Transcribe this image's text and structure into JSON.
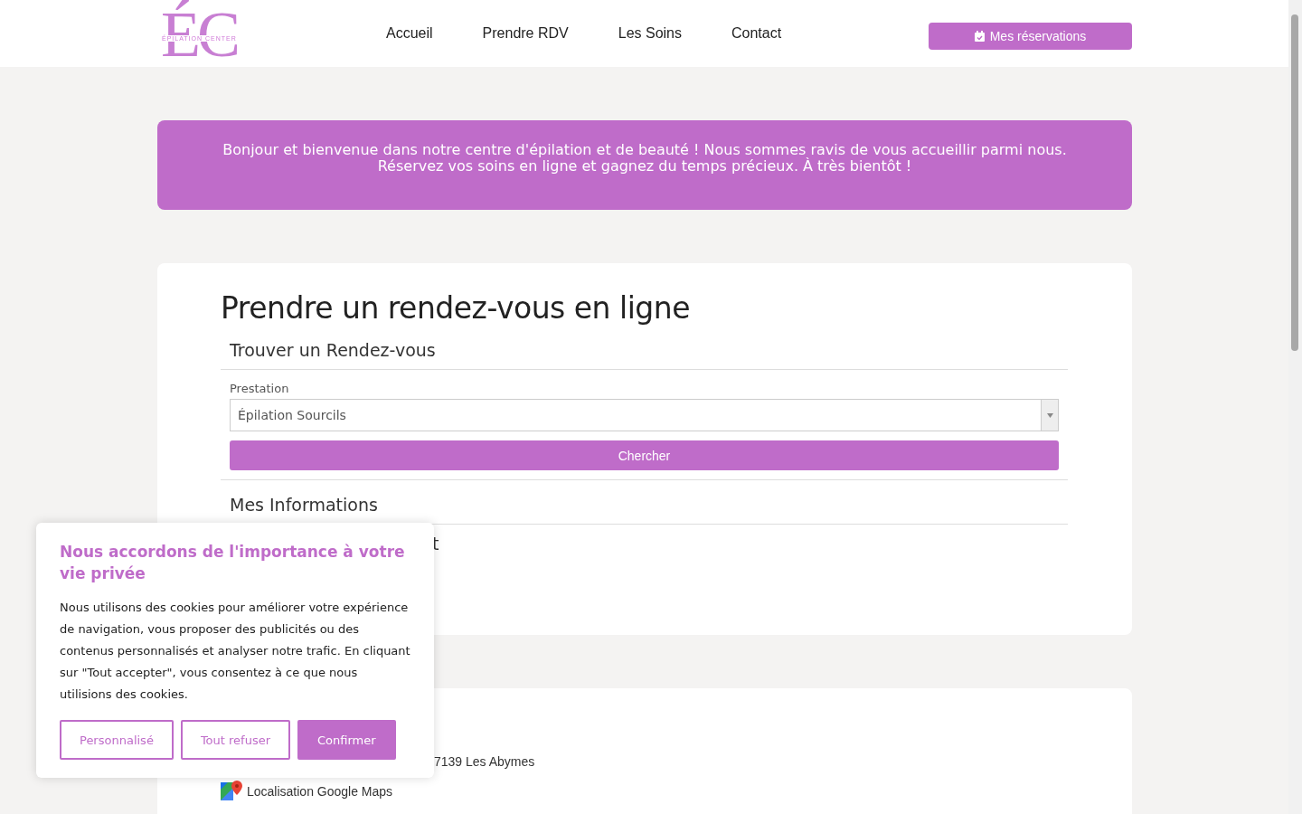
{
  "header": {
    "logo": {
      "letters": "ÉC",
      "tagline": "ÉPILATION CENTER"
    },
    "nav": [
      {
        "label": "Accueil"
      },
      {
        "label": "Prendre RDV"
      },
      {
        "label": "Les Soins"
      },
      {
        "label": "Contact"
      }
    ],
    "reservations_button": "Mes réservations"
  },
  "banner": "Bonjour et bienvenue dans notre centre d'épilation et de beauté ! Nous sommes ravis de vous accueillir parmi nous. Réservez vos soins en ligne et gagnez du temps précieux. À très bientôt !",
  "booking": {
    "title": "Prendre un rendez-vous en ligne",
    "find_section": {
      "heading": "Trouver un Rendez-vous",
      "field_label": "Prestation",
      "select_value": "Épilation Sourcils",
      "search_button": "Chercher"
    },
    "info_heading": "Mes Informations",
    "partial_heading": "t"
  },
  "contact": {
    "address_partial": "7139 Les Abymes",
    "maps_link": "Localisation Google Maps"
  },
  "cookie_dialog": {
    "title": "Nous accordons de l'importance à votre vie privée",
    "text": "Nous utilisons des cookies pour améliorer votre expérience de navigation, vous proposer des publicités ou des contenus personnalisés et analyser notre trafic. En cliquant sur \"Tout accepter\", vous consentez à ce que nous utilisions des cookies.",
    "buttons": [
      {
        "label": "Personnalisé",
        "kind": "outline"
      },
      {
        "label": "Tout refuser",
        "kind": "outline"
      },
      {
        "label": "Confirmer",
        "kind": "filled"
      }
    ]
  }
}
